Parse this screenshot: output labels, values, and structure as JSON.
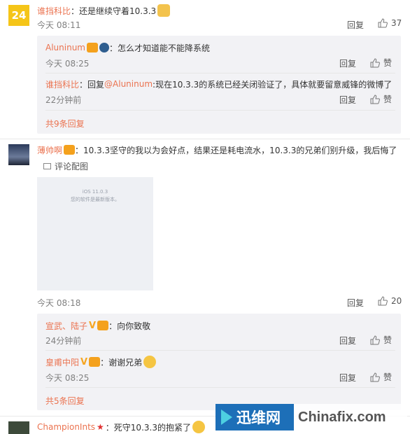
{
  "comments": [
    {
      "avatar_text": "24",
      "user": "谁挡科比",
      "text": "：还是继续守着10.3.3",
      "time": "今天 08:11",
      "reply_label": "回复",
      "like_count": "37",
      "replies": [
        {
          "user": "Aluninum",
          "text": "：怎么才知道能不能降系统",
          "time": "今天 08:25",
          "reply_label": "回复",
          "like_label": "赞"
        },
        {
          "user": "谁挡科比",
          "text_prefix": "：回复",
          "mention": "@Aluninum",
          "text": ":现在10.3.3的系统已经关闭验证了，具体就要留意威锋的微博了",
          "time": "22分钟前",
          "reply_label": "回复",
          "like_label": "赞"
        }
      ],
      "more_replies": "共9条回复"
    },
    {
      "user": "薄帅啊",
      "text": "：10.3.3坚守的我以为会好点，结果还是耗电流水，10.3.3的兄弟们别升级，我后悔了",
      "image_link": "评论配图",
      "screenshot_title": "iOS 11.0.3",
      "screenshot_sub": "您的软件是最新版本。",
      "time": "今天 08:18",
      "reply_label": "回复",
      "like_count": "20",
      "replies": [
        {
          "user": "宣武、陆子",
          "text": "：向你致敬",
          "time": "24分钟前",
          "reply_label": "回复",
          "like_label": "赞"
        },
        {
          "user": "皇甫中阳",
          "text": "：谢谢兄弟",
          "time": "今天 08:25",
          "reply_label": "回复",
          "like_label": "赞"
        }
      ],
      "more_replies": "共5条回复"
    },
    {
      "user": "ChampionInts",
      "text": "：死守10.3.3的抱紧了"
    }
  ],
  "watermark": {
    "brand_cn": "迅维网",
    "brand_en": "Chinafix.com"
  },
  "colors": {
    "link": "#eb7350",
    "reply_bg": "#f2f2f5",
    "watermark_left": "#1d6fb8",
    "watermark_right": "#555555"
  }
}
